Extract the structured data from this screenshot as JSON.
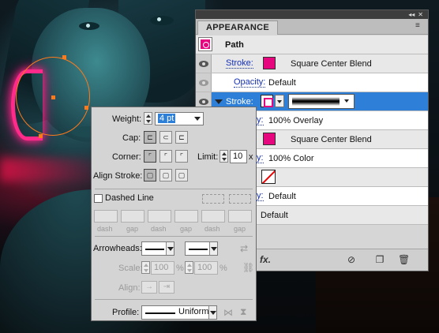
{
  "appearance": {
    "tab_label": "APPEARANCE",
    "titlebar_controls": [
      "◂◂",
      "✕"
    ],
    "menu_glyph": "≡",
    "path_label": "Path",
    "rows": [
      {
        "label": "Stroke:",
        "value": "Square Center Blend"
      },
      {
        "label": "Opacity:",
        "value": "Default"
      },
      {
        "label": "Stroke:",
        "value": ""
      },
      {
        "label": "y:",
        "value": "100% Overlay"
      },
      {
        "label": "",
        "value": "Square Center Blend"
      },
      {
        "label": "y:",
        "value": "100% Color"
      },
      {
        "label": "",
        "value": ""
      },
      {
        "label": "y:",
        "value": "Default"
      },
      {
        "label": "",
        "value": "Default"
      }
    ],
    "bottom_icons": {
      "fx": "fx.",
      "clear": "⊘",
      "duplicate": "❐",
      "delete": "🗑"
    },
    "colors": {
      "magenta": "#e6077e",
      "selection": "#2e7fd8"
    }
  },
  "stroke_panel": {
    "weight_label": "Weight:",
    "weight_value": "4 pt",
    "cap_label": "Cap:",
    "corner_label": "Corner:",
    "limit_label": "Limit:",
    "limit_value": "10",
    "limit_unit": "x",
    "align_label": "Align Stroke:",
    "dashed_label": "Dashed Line",
    "dash_labels": [
      "dash",
      "gap",
      "dash",
      "gap",
      "dash",
      "gap"
    ],
    "arrowheads_label": "Arrowheads:",
    "scale_label": "Scale:",
    "scale_a": "100",
    "scale_b": "100",
    "percent": "%",
    "align_label2": "Align:",
    "profile_label": "Profile:",
    "profile_value": "Uniform"
  }
}
